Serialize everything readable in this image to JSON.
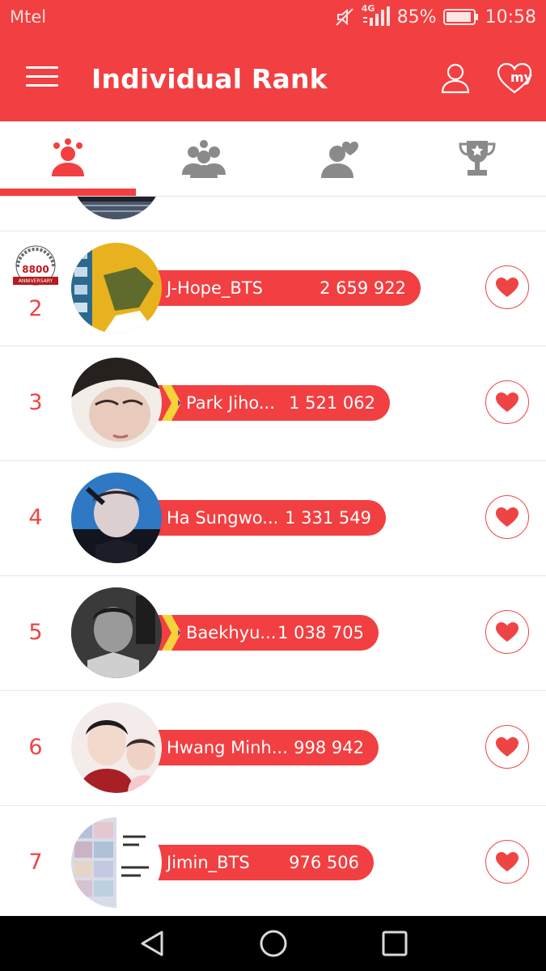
{
  "status_bar": {
    "carrier": "Mtel",
    "network": "4G",
    "battery": "85%",
    "time": "10:58"
  },
  "app_bar": {
    "title": "Individual Rank",
    "my_label": "my"
  },
  "tabs": [
    {
      "name": "individual",
      "icon": "person-group-icon",
      "active": true
    },
    {
      "name": "group",
      "icon": "people-group-icon",
      "active": false
    },
    {
      "name": "favorites",
      "icon": "person-heart-icon",
      "active": false
    },
    {
      "name": "trophy",
      "icon": "trophy-icon",
      "active": false
    }
  ],
  "badge": {
    "text": "8800",
    "subtitle": "ANNIVERSARY"
  },
  "rankings": [
    {
      "rank": "2",
      "name": "J-Hope_BTS",
      "votes": "2 659 922"
    },
    {
      "rank": "3",
      "name": "Park Jiho...",
      "votes": "1 521 062"
    },
    {
      "rank": "4",
      "name": "Ha Sungwo...",
      "votes": "1 331 549"
    },
    {
      "rank": "5",
      "name": "Baekhyu...",
      "votes": "1 038 705"
    },
    {
      "rank": "6",
      "name": "Hwang Minh...",
      "votes": "998 942"
    },
    {
      "rank": "7",
      "name": "Jimin_BTS",
      "votes": "976 506"
    }
  ],
  "colors": {
    "accent": "#f23f41",
    "rank_text": "#ef4444",
    "divider": "#e8e8e8"
  }
}
